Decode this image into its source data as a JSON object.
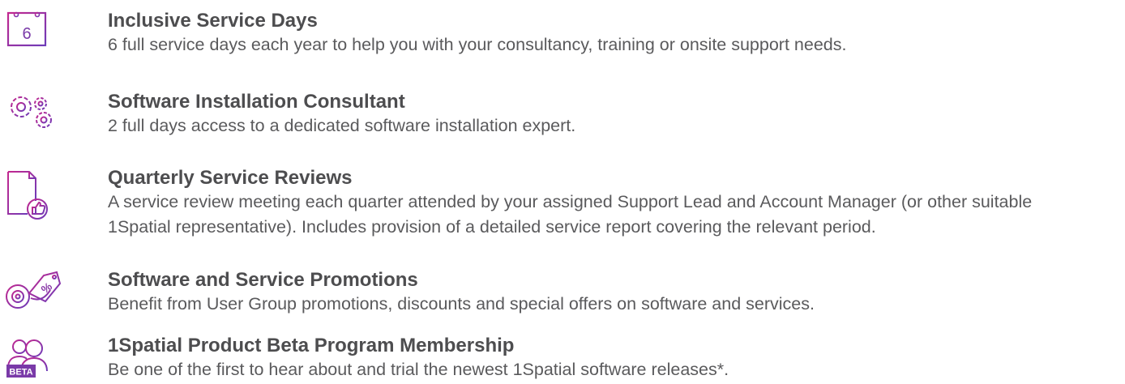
{
  "colors": {
    "icon_gradient_start": "#c2278f",
    "icon_gradient_end": "#6d3bb8",
    "title": "#4d4d4f",
    "text": "#5a5a5c"
  },
  "items": [
    {
      "icon": "calendar-icon",
      "icon_label": "6",
      "title": "Inclusive Service Days",
      "description": "6 full service days each year to help you with your consultancy, training or onsite support needs."
    },
    {
      "icon": "gears-icon",
      "title": "Software Installation Consultant",
      "description": "2 full days access to a dedicated software installation expert."
    },
    {
      "icon": "report-thumbs-up-icon",
      "title": "Quarterly Service Reviews",
      "description_lines": [
        "A service review meeting each quarter attended by your assigned Support Lead and Account Manager (or other suitable",
        "1Spatial representative). Includes provision of a detailed service report covering the relevant period."
      ]
    },
    {
      "icon": "disc-discount-tag-icon",
      "icon_label": "%",
      "title": "Software and Service Promotions",
      "description": "Benefit from User Group promotions, discounts and special offers on software and services."
    },
    {
      "icon": "beta-users-icon",
      "icon_label": "BETA",
      "title": "1Spatial Product Beta Program Membership",
      "description": "Be one of the first to hear about and trial the newest 1Spatial software releases*."
    }
  ]
}
